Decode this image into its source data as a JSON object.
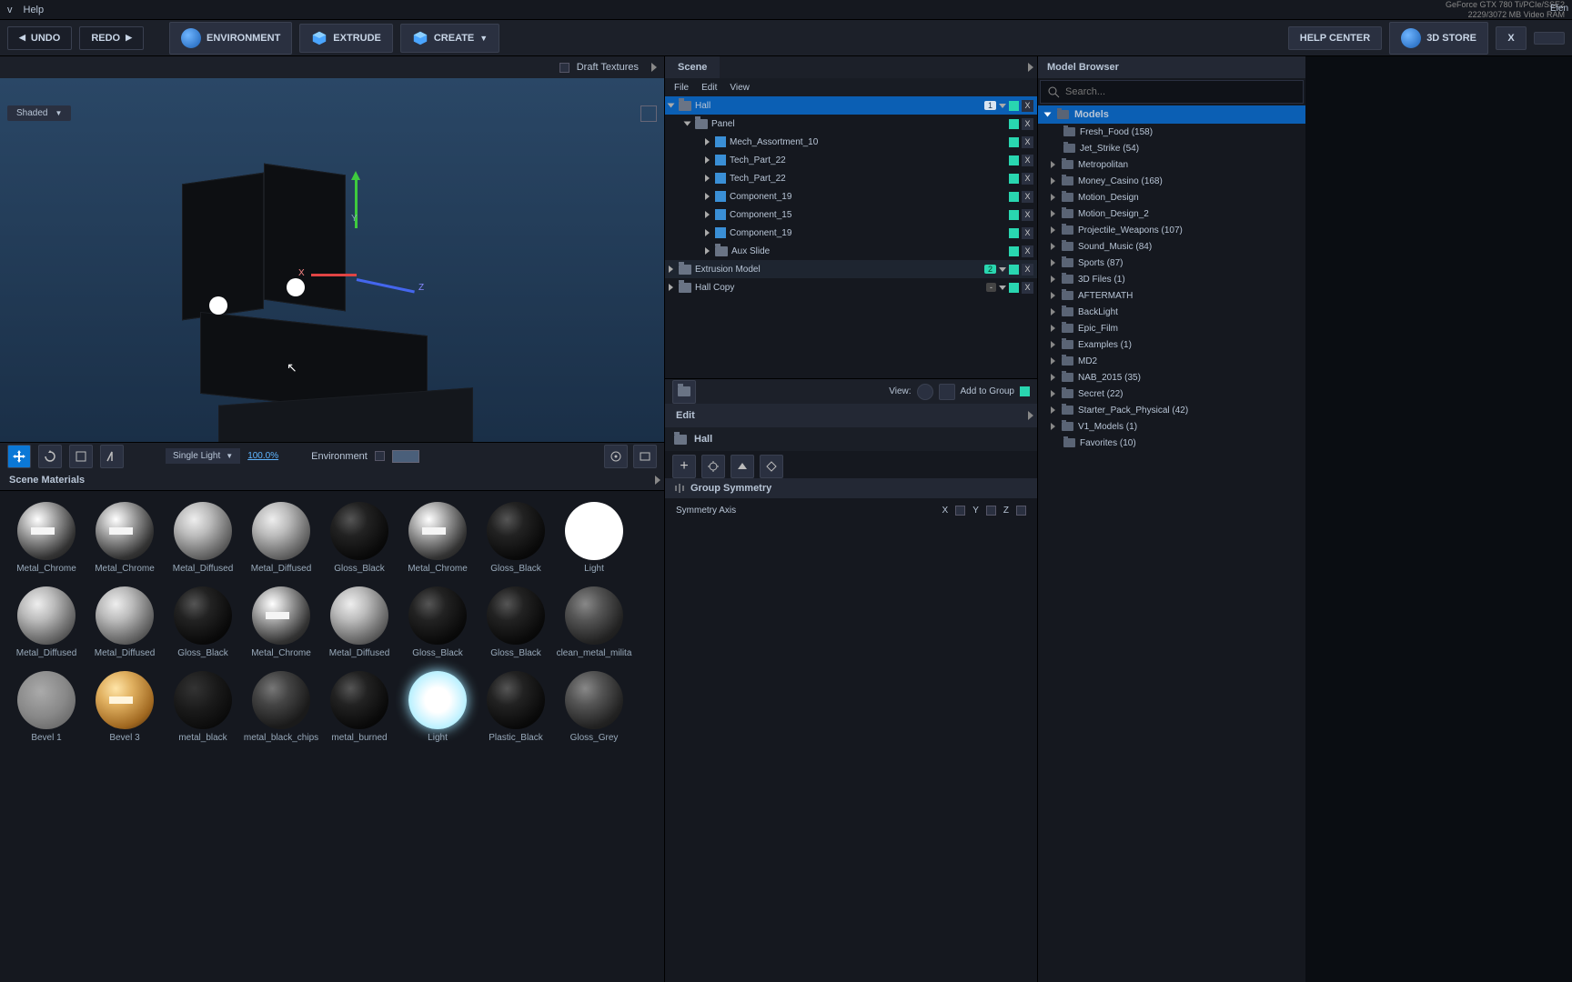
{
  "menu": {
    "view": "v",
    "help": "Help"
  },
  "gpu": {
    "line1": "GeForce GTX 780 Ti/PCIe/SSE2",
    "line2": "2229/3072 MB Video RAM",
    "corner": "Elen"
  },
  "toolbar": {
    "undo": "UNDO",
    "redo": "REDO",
    "environment": "ENVIRONMENT",
    "extrude": "EXTRUDE",
    "create": "CREATE",
    "helpcenter": "HELP CENTER",
    "store": "3D STORE",
    "close": "X"
  },
  "viewport": {
    "draft": "Draft Textures",
    "shaded": "Shaded",
    "single_light": "Single Light",
    "zoom": "100.0%",
    "environment_lbl": "Environment",
    "axis": {
      "x": "X",
      "y": "Y",
      "z": "Z"
    }
  },
  "materials_header": "Scene Materials",
  "materials": [
    {
      "label": "Metal_Chrome",
      "style": "sph-chrome"
    },
    {
      "label": "Metal_Chrome",
      "style": "sph-chrome"
    },
    {
      "label": "Metal_Diffused",
      "style": "sph-diffused"
    },
    {
      "label": "Metal_Diffused",
      "style": "sph-diffused"
    },
    {
      "label": "Gloss_Black",
      "style": "sph-gloss-black"
    },
    {
      "label": "Metal_Chrome",
      "style": "sph-chrome"
    },
    {
      "label": "Gloss_Black",
      "style": "sph-gloss-black"
    },
    {
      "label": "Light",
      "style": "sph-light"
    },
    {
      "label": "Metal_Diffused",
      "style": "sph-diffused"
    },
    {
      "label": "Metal_Diffused",
      "style": "sph-diffused"
    },
    {
      "label": "Gloss_Black",
      "style": "sph-gloss-black"
    },
    {
      "label": "Metal_Chrome",
      "style": "sph-chrome"
    },
    {
      "label": "Metal_Diffused",
      "style": "sph-diffused"
    },
    {
      "label": "Gloss_Black",
      "style": "sph-gloss-black"
    },
    {
      "label": "Gloss_Black",
      "style": "sph-gloss-black"
    },
    {
      "label": "clean_metal_milita",
      "style": "sph-grey-gloss"
    },
    {
      "label": "Bevel 1",
      "style": "sph-bevel"
    },
    {
      "label": "Bevel 3",
      "style": "sph-gold"
    },
    {
      "label": "metal_black",
      "style": "sph-dark"
    },
    {
      "label": "metal_black_chips",
      "style": "sph-chips"
    },
    {
      "label": "metal_burned",
      "style": "sph-gloss-black"
    },
    {
      "label": "Light",
      "style": "sph-light-glow"
    },
    {
      "label": "Plastic_Black",
      "style": "sph-gloss-black"
    },
    {
      "label": "Gloss_Grey",
      "style": "sph-grey-gloss"
    }
  ],
  "scene": {
    "tab": "Scene",
    "menu": {
      "file": "File",
      "edit": "Edit",
      "view": "View"
    },
    "tree": {
      "hall": "Hall",
      "hall_badge": "1",
      "panel": "Panel",
      "items": [
        "Mech_Assortment_10",
        "Tech_Part_22",
        "Tech_Part_22",
        "Component_19",
        "Component_15",
        "Component_19",
        "Aux Slide"
      ],
      "extrusion": "Extrusion Model",
      "extrusion_badge": "2",
      "hallcopy": "Hall Copy",
      "hallcopy_badge": "-"
    },
    "footer": {
      "view": "View:",
      "add": "Add to Group"
    },
    "edit_hdr": "Edit",
    "edit_obj": "Hall",
    "symmetry": {
      "title": "Group Symmetry",
      "axis_lbl": "Symmetry Axis",
      "x": "X",
      "y": "Y",
      "z": "Z"
    }
  },
  "browser": {
    "title": "Model Browser",
    "search_ph": "Search...",
    "models_hdr": "Models",
    "items": [
      "Fresh_Food (158)",
      "Jet_Strike (54)",
      "Metropolitan",
      "Money_Casino (168)",
      "Motion_Design",
      "Motion_Design_2",
      "Projectile_Weapons (107)",
      "Sound_Music (84)",
      "Sports (87)",
      "3D Files (1)",
      "AFTERMATH",
      "BackLight",
      "Epic_Film",
      "Examples (1)",
      "MD2",
      "NAB_2015 (35)",
      "Secret (22)",
      "Starter_Pack_Physical (42)",
      "V1_Models (1)",
      "Favorites (10)"
    ]
  }
}
